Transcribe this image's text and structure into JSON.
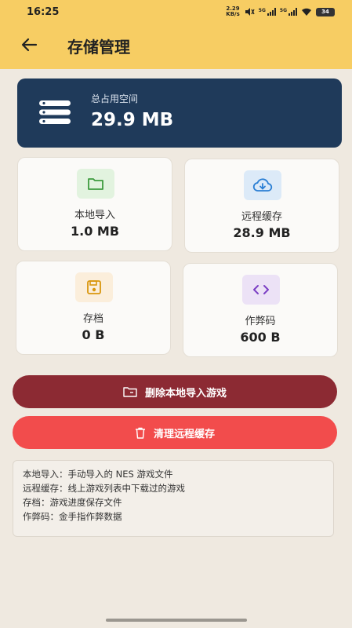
{
  "status_bar": {
    "time": "16:25",
    "net_speed_value": "2.29",
    "net_speed_unit": "KB/s",
    "sim1_label": "5G",
    "sim2_label": "5G",
    "battery": "34"
  },
  "header": {
    "title": "存储管理"
  },
  "total": {
    "label": "总占用空间",
    "value": "29.9 MB"
  },
  "stats": [
    {
      "label": "本地导入",
      "value": "1.0 MB",
      "icon": "folder-icon",
      "color": "#3e9b3e",
      "bg": "#e2f3df"
    },
    {
      "label": "远程缓存",
      "value": "28.9 MB",
      "icon": "cloud-download-icon",
      "color": "#2b7fd4",
      "bg": "#dceaf8"
    },
    {
      "label": "存档",
      "value": "0 B",
      "icon": "save-icon",
      "color": "#d9960d",
      "bg": "#fbeedb"
    },
    {
      "label": "作弊码",
      "value": "600 B",
      "icon": "code-icon",
      "color": "#7b3fc4",
      "bg": "#ece2f6"
    }
  ],
  "buttons": {
    "delete_local": "删除本地导入游戏",
    "clear_remote": "清理远程缓存"
  },
  "info": [
    "本地导入：手动导入的 NES 游戏文件",
    "远程缓存：线上游戏列表中下载过的游戏",
    "存档：游戏进度保存文件",
    "作弊码：金手指作弊数据"
  ],
  "colors": {
    "header_bg": "#f7cd63",
    "total_card_bg": "#1f3a5a",
    "delete_button": "#8c2a33",
    "clear_button": "#f24c4c"
  }
}
